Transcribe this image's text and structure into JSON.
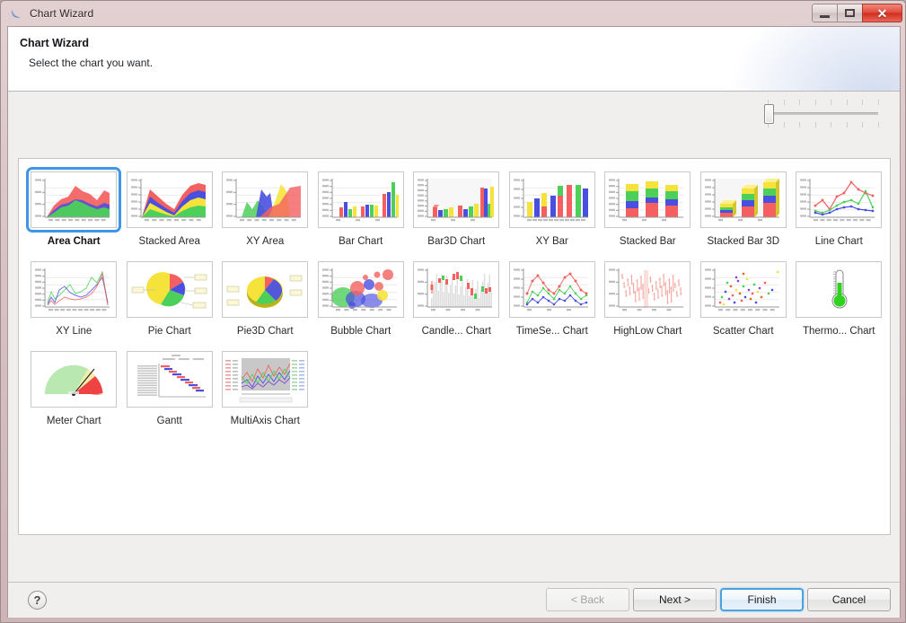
{
  "window": {
    "title": "Chart Wizard",
    "icon": "chart-wizard-icon",
    "buttons": {
      "minimize": "Minimize",
      "maximize": "Restore",
      "close": "Close"
    }
  },
  "header": {
    "title": "Chart Wizard",
    "subtitle": "Select the chart you want."
  },
  "slider": {
    "name": "thumbnail-size-slider",
    "value": 0,
    "min": 0,
    "max": 100,
    "ticks": 7
  },
  "charts": [
    {
      "label": "Area Chart",
      "type": "area",
      "selected": true
    },
    {
      "label": "Stacked Area",
      "type": "stacked-area",
      "selected": false
    },
    {
      "label": "XY Area",
      "type": "xy-area",
      "selected": false
    },
    {
      "label": "Bar Chart",
      "type": "bar",
      "selected": false
    },
    {
      "label": "Bar3D Chart",
      "type": "bar3d",
      "selected": false
    },
    {
      "label": "XY Bar",
      "type": "xy-bar",
      "selected": false
    },
    {
      "label": "Stacked Bar",
      "type": "stacked-bar",
      "selected": false
    },
    {
      "label": "Stacked Bar 3D",
      "type": "stacked-bar3d",
      "selected": false
    },
    {
      "label": "Line Chart",
      "type": "line",
      "selected": false
    },
    {
      "label": "XY Line",
      "type": "xy-line",
      "selected": false
    },
    {
      "label": "Pie Chart",
      "type": "pie",
      "selected": false
    },
    {
      "label": "Pie3D Chart",
      "type": "pie3d",
      "selected": false
    },
    {
      "label": "Bubble Chart",
      "type": "bubble",
      "selected": false
    },
    {
      "label": "Candle... Chart",
      "type": "candlestick",
      "selected": false
    },
    {
      "label": "TimeSe... Chart",
      "type": "timeseries",
      "selected": false
    },
    {
      "label": "HighLow Chart",
      "type": "highlow",
      "selected": false
    },
    {
      "label": "Scatter Chart",
      "type": "scatter",
      "selected": false
    },
    {
      "label": "Thermo... Chart",
      "type": "thermometer",
      "selected": false
    },
    {
      "label": "Meter Chart",
      "type": "meter",
      "selected": false
    },
    {
      "label": "Gantt",
      "type": "gantt",
      "selected": false
    },
    {
      "label": "MultiAxis Chart",
      "type": "multiaxis",
      "selected": false
    }
  ],
  "footer": {
    "help": "?",
    "back": "< Back",
    "next": "Next >",
    "finish": "Finish",
    "cancel": "Cancel"
  },
  "colors": {
    "accent": "#3d96e8",
    "default_button_border": "#4aa3e0",
    "series_red": "#f4605f",
    "series_green": "#4cd05a",
    "series_blue": "#4a4fe0",
    "series_yellow": "#f5e33c",
    "close_button": "#e2483a"
  }
}
